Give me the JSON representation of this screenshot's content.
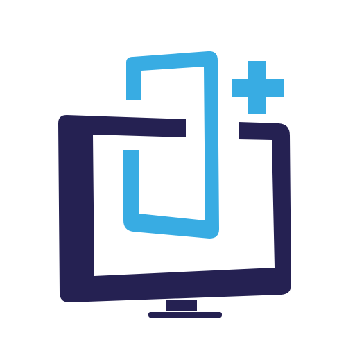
{
  "logo": {
    "icon_name": "monitor-phone-plus-icon",
    "colors": {
      "background": "#ffffff",
      "monitor": "#252152",
      "phone": "#38ace3",
      "plus": "#38ace3"
    }
  }
}
